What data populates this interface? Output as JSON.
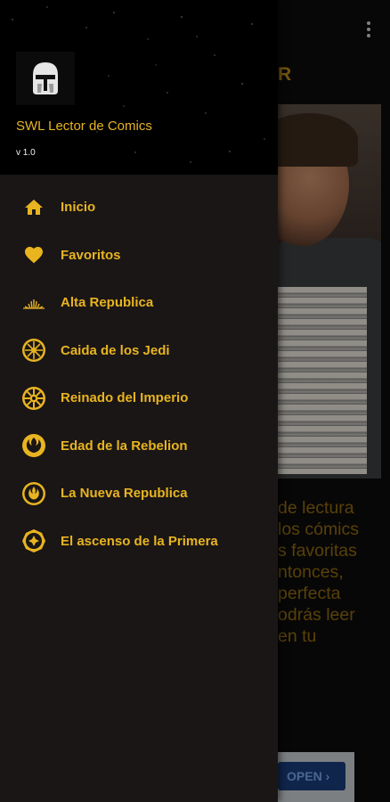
{
  "background": {
    "title_fragment": "R",
    "text_lines": [
      "de lectura",
      "los cómics",
      "s favoritas",
      "ntonces,",
      "perfecta",
      "odrás leer",
      "en tu"
    ],
    "open_button": "OPEN ›"
  },
  "drawer": {
    "app_name": "SWL Lector de Comics",
    "version": "v 1.0",
    "logo_icon": "mandalorian-helmet-icon",
    "items": [
      {
        "label": "Inicio",
        "icon": "home-icon"
      },
      {
        "label": "Favoritos",
        "icon": "heart-icon"
      },
      {
        "label": "Alta Republica",
        "icon": "high-republic-icon"
      },
      {
        "label": "Caida de los Jedi",
        "icon": "republic-emblem-icon"
      },
      {
        "label": "Reinado del Imperio",
        "icon": "empire-emblem-icon"
      },
      {
        "label": "Edad de la Rebelion",
        "icon": "rebel-emblem-icon"
      },
      {
        "label": "La Nueva Republica",
        "icon": "new-republic-emblem-icon"
      },
      {
        "label": "El ascenso de la Primera",
        "icon": "first-order-emblem-icon"
      }
    ]
  },
  "colors": {
    "accent": "#e8b41f",
    "drawer_bg": "#1a1616",
    "header_bg": "#000000"
  }
}
